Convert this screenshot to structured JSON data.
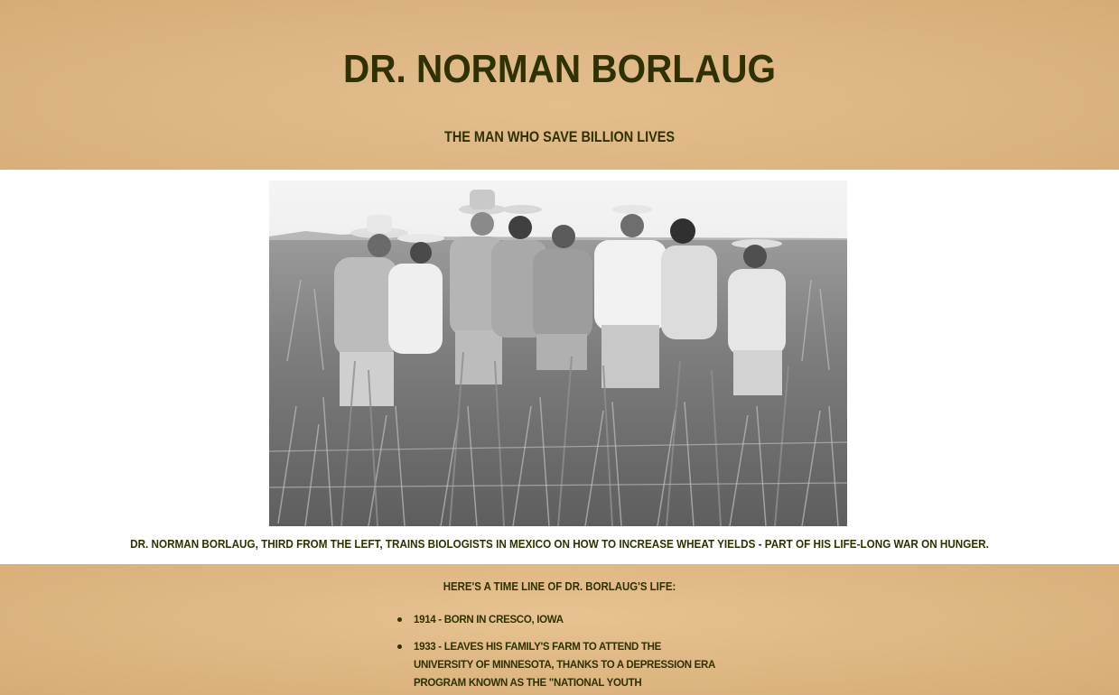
{
  "header": {
    "title": "Dr. Norman Borlaug",
    "subtitle": "The man who save billion lives"
  },
  "photo": {
    "caption": "Dr. Norman Borlaug, third from the left, trains biologists in Mexico on how to increase wheat yields - part of his life-long war on hunger."
  },
  "timeline": {
    "heading": "Here's a time line of Dr. Borlaug's life:",
    "items": [
      {
        "year": "1914",
        "text": " - born in Cresco, Iowa"
      },
      {
        "year": "1933",
        "text": " - leaves his family's farm to attend the University of Minnesota, thanks to a Depression era program known as the \"National Youth Administration\""
      }
    ]
  }
}
